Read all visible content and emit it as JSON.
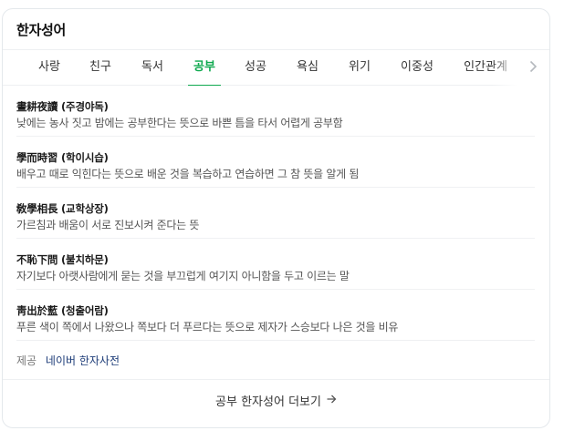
{
  "card": {
    "title": "한자성어"
  },
  "tabs": [
    {
      "label": "사랑",
      "active": false
    },
    {
      "label": "친구",
      "active": false
    },
    {
      "label": "독서",
      "active": false
    },
    {
      "label": "공부",
      "active": true
    },
    {
      "label": "성공",
      "active": false
    },
    {
      "label": "욕심",
      "active": false
    },
    {
      "label": "위기",
      "active": false
    },
    {
      "label": "이중성",
      "active": false
    },
    {
      "label": "인간관계",
      "active": false
    }
  ],
  "idioms": [
    {
      "head": "晝耕夜讀 (주경야독)",
      "desc": "낮에는 농사 짓고 밤에는 공부한다는 뜻으로 바쁜 틈을 타서 어렵게 공부함"
    },
    {
      "head": "學而時習 (학이시습)",
      "desc": "배우고 때로 익힌다는 뜻으로 배운 것을 복습하고 연습하면 그 참 뜻을 알게 됨"
    },
    {
      "head": "敎學相長 (교학상장)",
      "desc": "가르침과 배움이 서로 진보시켜 준다는 뜻"
    },
    {
      "head": "不恥下問 (불치하문)",
      "desc": "자기보다 아랫사람에게 묻는 것을 부끄럽게 여기지 아니함을 두고 이르는 말"
    },
    {
      "head": "靑出於藍 (청출어람)",
      "desc": "푸른 색이 쪽에서 나왔으나 쪽보다 더 푸르다는 뜻으로 제자가 스승보다 나은 것을 비유"
    }
  ],
  "provider": {
    "label": "제공",
    "link": "네이버 한자사전"
  },
  "more": {
    "label": "공부 한자성어 더보기"
  },
  "icons": {
    "next": "chevron-right-icon",
    "more": "arrow-right-icon"
  },
  "colors": {
    "accent": "#0fa94f",
    "link": "#1d3c78"
  }
}
